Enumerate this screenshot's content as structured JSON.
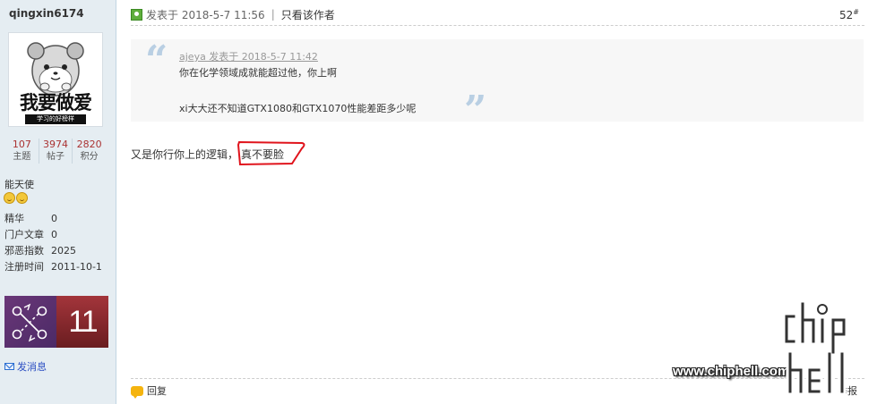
{
  "user": {
    "name": "qingxin6174",
    "avatar_text": "我要做爱",
    "avatar_subtext": "学习的好榜样",
    "stats": [
      {
        "value": "107",
        "label": "主题"
      },
      {
        "value": "3974",
        "label": "帖子"
      },
      {
        "value": "2820",
        "label": "积分"
      }
    ],
    "group": "能天使",
    "info": [
      {
        "key": "精华",
        "value": "0"
      },
      {
        "key": "门户文章",
        "value": "0"
      },
      {
        "key": "邪恶指数",
        "value": "2025"
      },
      {
        "key": "注册时间",
        "value": "2011-10-1"
      }
    ],
    "medal_number": "11",
    "send_message": "发消息"
  },
  "post": {
    "posted_on": "发表于 2018-5-7 11:56",
    "author_only": "只看该作者",
    "floor": "52",
    "floor_mark": "#",
    "quote": {
      "meta": "ajeya 发表于 2018-5-7 11:42",
      "line1": "你在化学领域成就能超过他，你上啊",
      "line2": "xi大大还不知道GTX1080和GTX1070性能差距多少呢"
    },
    "reply_prefix": "又是你行你上的逻辑，",
    "reply_highlight": "真不要脸",
    "reply_button": "回复",
    "report_button": "举报"
  },
  "watermark": {
    "url": "www.chiphell.com",
    "logo_text": "chiphell"
  },
  "colors": {
    "sidebar_bg": "#e5edf2",
    "stat_number": "#aa3333",
    "link_blue": "#2b4ec2",
    "scribble_red": "#e0141c",
    "quote_bg": "#f7f7f7"
  }
}
